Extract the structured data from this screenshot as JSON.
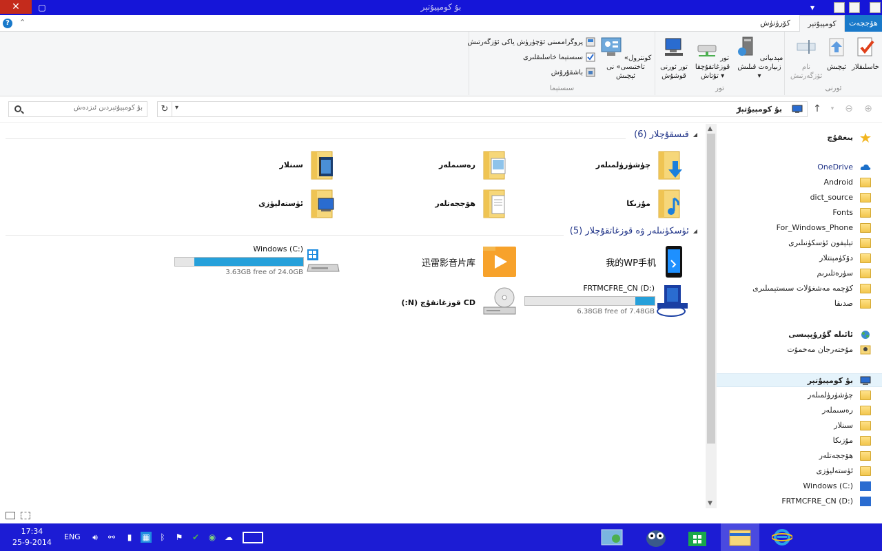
{
  "window": {
    "title": "بۇ كومپيۇتېر"
  },
  "ribbon_tabs": [
    {
      "label": "ھۆججەت"
    },
    {
      "label": "كومپيۇتېر"
    },
    {
      "label": "كۆرۈنۈش"
    }
  ],
  "ribbon": {
    "groups": [
      {
        "label": "ئورنى",
        "buttons": [
          "خاسلىقلار",
          "ئېچىش",
          "نام ئۆزگەرتىش"
        ]
      },
      {
        "label": "تور",
        "buttons": [
          "مېدىيانى زىيارەت قىلىش",
          "تور قوزغاتقۇچقا تۇتاش",
          "تور ئورنى قوشۇش"
        ]
      },
      {
        "label": "سىستېما",
        "big_button": "«كونترول تاختىسى» نى ئېچىش",
        "small_buttons": [
          "پروگراممىنى ئۆچۈرۈش ياكى ئۆزگەرتىش",
          "سىستېما خاسلىقلىرى",
          "باشقۇرۇش"
        ]
      }
    ]
  },
  "address": {
    "path": "بۇ كومپيۇتېر",
    "search_placeholder": "بۇ كومپيۇتېردىن ئىزدەش"
  },
  "folders_group": {
    "title": "قىسقۇچلار (6)",
    "items": [
      "چۈشۈرۈلمىلەر",
      "رەسىملەر",
      "سىنلار",
      "مۇزىكا",
      "ھۆججەتلەر",
      "ئۈستەلیۈزى"
    ]
  },
  "drives_group": {
    "title": "ئۈسكۈنىلەر ۋە قوزغاتقۇچلار (5)",
    "items": [
      {
        "name": "我的WP手机"
      },
      {
        "name": "迅雷影音片库"
      },
      {
        "name": "Windows (C:)",
        "free": "3.63GB free of 24.0GB",
        "used_fraction": 0.85
      },
      {
        "name": "FRTMCFRE_CN (D:)",
        "free": "6.38GB free of 7.48GB",
        "used_fraction": 0.15
      },
      {
        "name": "CD قوزغاتقۇچ (N:)"
      }
    ]
  },
  "navpane": {
    "favorites": "يىغقۇچ",
    "onedrive": "OneDrive",
    "onedrive_items": [
      "Android",
      "dict_source",
      "Fonts",
      "For_Windows_Phone",
      "تېلېفون ئۈسكۈنىلىرى",
      "دۆكۈمېنتلار",
      "سۈرەتلىرىم",
      "كۆچمە مەشغۇلات سىستېمىلىرى",
      "صدىقا"
    ],
    "homegroup": "ئائىلە گۇرۇپپىسى",
    "homegroup_user": "مۇختەرجان مەخمۇت",
    "this_pc": "بۇ كومپيۇتېر",
    "this_pc_items": [
      "چۈشۈرۈلمىلەر",
      "رەسىملەر",
      "سىنلار",
      "مۇزىكا",
      "ھۆججەتلەر",
      "ئۈستەلیۈزى",
      "Windows (C:)",
      "FRTMCFRE_CN (D:)"
    ]
  },
  "taskbar": {
    "time": "17:34",
    "date": "25-9-2014",
    "lang": "ENG"
  },
  "colors": {
    "accent": "#1979ca",
    "taskbar": "#1c1cd4",
    "drive_fill": "#26a0da"
  }
}
